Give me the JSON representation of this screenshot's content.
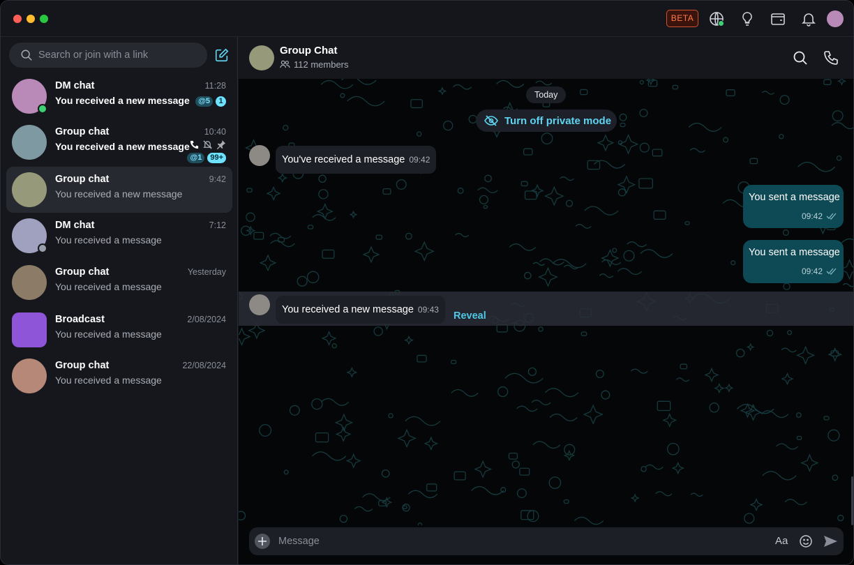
{
  "titlebar": {
    "beta_label": "BETA",
    "icons": [
      "globe-icon",
      "lightbulb-icon",
      "wallet-icon",
      "bell-icon",
      "profile-avatar"
    ]
  },
  "sidebar": {
    "search_placeholder": "Search or join with a link",
    "chats": [
      {
        "name": "DM chat",
        "preview": "You received a new message",
        "time": "11:28",
        "mentions": "@5",
        "unread": "1",
        "status": "online"
      },
      {
        "name": "Group chat",
        "preview": "You received a new message",
        "time": "10:40",
        "mentions": "@1",
        "unread": "99+"
      },
      {
        "name": "Group chat",
        "preview": "You received a new message",
        "time": "9:42"
      },
      {
        "name": "DM chat",
        "preview": "You received a message",
        "time": "7:12",
        "status": "away"
      },
      {
        "name": "Group chat",
        "preview": "You received a message",
        "time": "Yesterday"
      },
      {
        "name": "Broadcast",
        "preview": "You received a message",
        "time": "2/08/2024"
      },
      {
        "name": "Group chat",
        "preview": "You received a message",
        "time": "22/08/2024"
      }
    ]
  },
  "chat": {
    "title": "Group Chat",
    "members": "112 members",
    "date_divider": "Today",
    "private_mode_label": "Turn off private mode",
    "messages": [
      {
        "direction": "in",
        "text": "You've received a message",
        "time": "09:42"
      },
      {
        "direction": "out",
        "text": "You sent a message",
        "time": "09:42"
      },
      {
        "direction": "out",
        "text": "You sent a message",
        "time": "09:42"
      },
      {
        "direction": "in",
        "text": "You received a new message",
        "time": "09:43",
        "private": true
      }
    ],
    "reveal_label": "Reveal",
    "composer_placeholder": "Message",
    "format_label": "Aa"
  },
  "colors": {
    "accent": "#5ed4f0",
    "online": "#3ed174",
    "outgoing_bubble": "#0e4a55",
    "beta": "#ff7a45"
  }
}
